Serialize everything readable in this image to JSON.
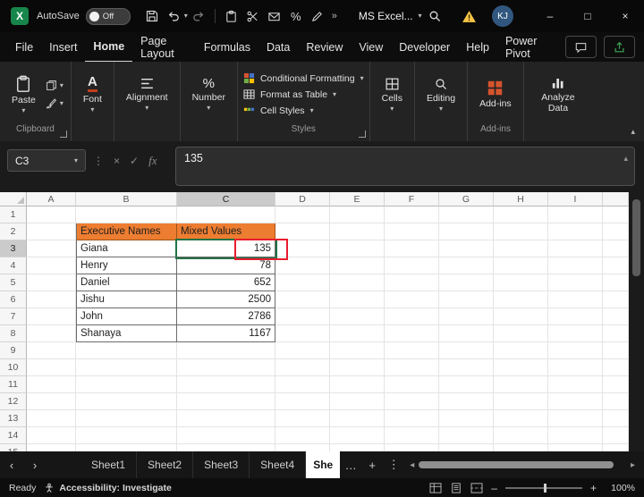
{
  "titlebar": {
    "autosave_label": "AutoSave",
    "autosave_state": "Off",
    "doc_title": "MS Excel...",
    "avatar_initials": "KJ"
  },
  "menubar": {
    "items": [
      "File",
      "Insert",
      "Home",
      "Page Layout",
      "Formulas",
      "Data",
      "Review",
      "View",
      "Developer",
      "Help",
      "Power Pivot"
    ],
    "active": "Home"
  },
  "ribbon": {
    "paste": "Paste",
    "font": "Font",
    "alignment": "Alignment",
    "number": "Number",
    "styles_items": [
      "Conditional Formatting",
      "Format as Table",
      "Cell Styles"
    ],
    "cells": "Cells",
    "editing": "Editing",
    "addins": "Add-ins",
    "analyze_data": "Analyze Data",
    "group_labels": {
      "clipboard": "Clipboard",
      "styles": "Styles",
      "addins": "Add-ins"
    }
  },
  "formula_bar": {
    "name_box": "C3",
    "fx_label": "fx",
    "content": "135"
  },
  "sheet": {
    "columns": [
      "A",
      "B",
      "C",
      "D",
      "E",
      "F",
      "G",
      "H",
      "I"
    ],
    "rows": 15,
    "selected_cell": "C3",
    "annotated_value": "135",
    "table": {
      "origin": "B2",
      "headers": [
        "Executive Names",
        "Mixed Values"
      ],
      "rows": [
        [
          "Giana",
          135
        ],
        [
          "Henry",
          78
        ],
        [
          "Daniel",
          652
        ],
        [
          "Jishu",
          2500
        ],
        [
          "John",
          2786
        ],
        [
          "Shanaya",
          1167
        ]
      ]
    },
    "colors": {
      "header_fill": "#ED7D31",
      "selection": "#217346",
      "annotation": "#E81C2E"
    }
  },
  "sheet_tabs": {
    "tabs": [
      "Sheet1",
      "Sheet2",
      "Sheet3",
      "Sheet4",
      "She"
    ],
    "active": "She"
  },
  "statusbar": {
    "mode": "Ready",
    "accessibility": "Accessibility: Investigate",
    "zoom": "100%"
  },
  "icons": {
    "chevron_down": "▾",
    "chevron_up": "▴",
    "overflow": "»",
    "window_min": "–",
    "window_max": "□",
    "window_close": "×",
    "cancel": "×",
    "confirm": "✓",
    "kebab": "⋮",
    "more": "…",
    "new_sheet": "+",
    "nav_left": "‹",
    "nav_right": "›",
    "scroll_left": "◂",
    "scroll_right": "▸",
    "zoom_out": "–",
    "zoom_in": "+",
    "percent": "%"
  }
}
